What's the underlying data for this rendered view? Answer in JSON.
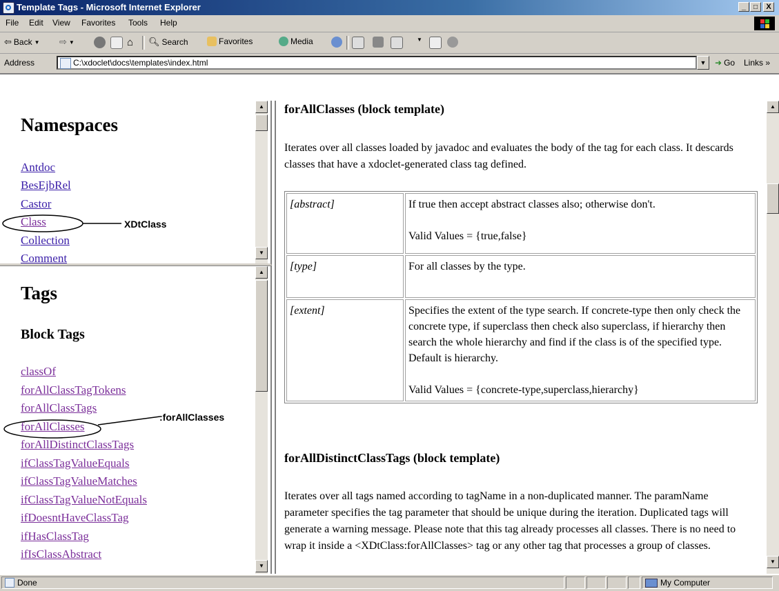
{
  "window": {
    "title": "Template Tags - Microsoft Internet Explorer",
    "minimize": "_",
    "maximize": "□",
    "close": "X"
  },
  "menu": [
    "File",
    "Edit",
    "View",
    "Favorites",
    "Tools",
    "Help"
  ],
  "toolbar": {
    "back": "Back",
    "search": "Search",
    "favorites": "Favorites",
    "media": "Media"
  },
  "address": {
    "label": "Address",
    "value": "C:\\xdoclet\\docs\\templates\\index.html",
    "go": "Go",
    "links": "Links »"
  },
  "namespaces": {
    "heading": "Namespaces",
    "items": [
      "Antdoc",
      "BesEjbRel",
      "Castor",
      "Class",
      "Collection",
      "Comment"
    ],
    "annotation": "XDtClass"
  },
  "tags": {
    "heading": "Tags",
    "subheading": "Block Tags",
    "items": [
      "classOf",
      "forAllClassTagTokens",
      "forAllClassTags",
      "forAllClasses",
      "forAllDistinctClassTags",
      "ifClassTagValueEquals",
      "ifClassTagValueMatches",
      "ifClassTagValueNotEquals",
      "ifDoesntHaveClassTag",
      "ifHasClassTag",
      "ifIsClassAbstract"
    ],
    "annotation": ":forAllClasses"
  },
  "content": {
    "heading1": "forAllClasses (block template)",
    "para1": "Iterates over all classes loaded by javadoc and evaluates the body of the tag for each class. It descards classes that have a xdoclet-generated class tag defined.",
    "params": [
      {
        "name": "[abstract]",
        "desc": "If true then accept abstract classes also; otherwise don't.",
        "valid": "Valid Values = {true,false}"
      },
      {
        "name": "[type]",
        "desc": "For all classes by the type.",
        "valid": ""
      },
      {
        "name": "[extent]",
        "desc": "Specifies the extent of the type search. If concrete-type then only check the concrete type, if superclass then check also superclass, if hierarchy then search the whole hierarchy and find if the class is of the specified type. Default is hierarchy.",
        "valid": "Valid Values = {concrete-type,superclass,hierarchy}"
      }
    ],
    "heading2": "forAllDistinctClassTags (block template)",
    "para2": "Iterates over all tags named according to tagName in a non-duplicated manner. The paramName parameter specifies the tag parameter that should be unique during the iteration. Duplicated tags will generate a warning message. Please note that this tag already processes all classes. There is no need to wrap it inside a <XDtClass:forAllClasses> tag or any other tag that processes a group of classes."
  },
  "status": {
    "text": "Done",
    "zone": "My Computer"
  }
}
